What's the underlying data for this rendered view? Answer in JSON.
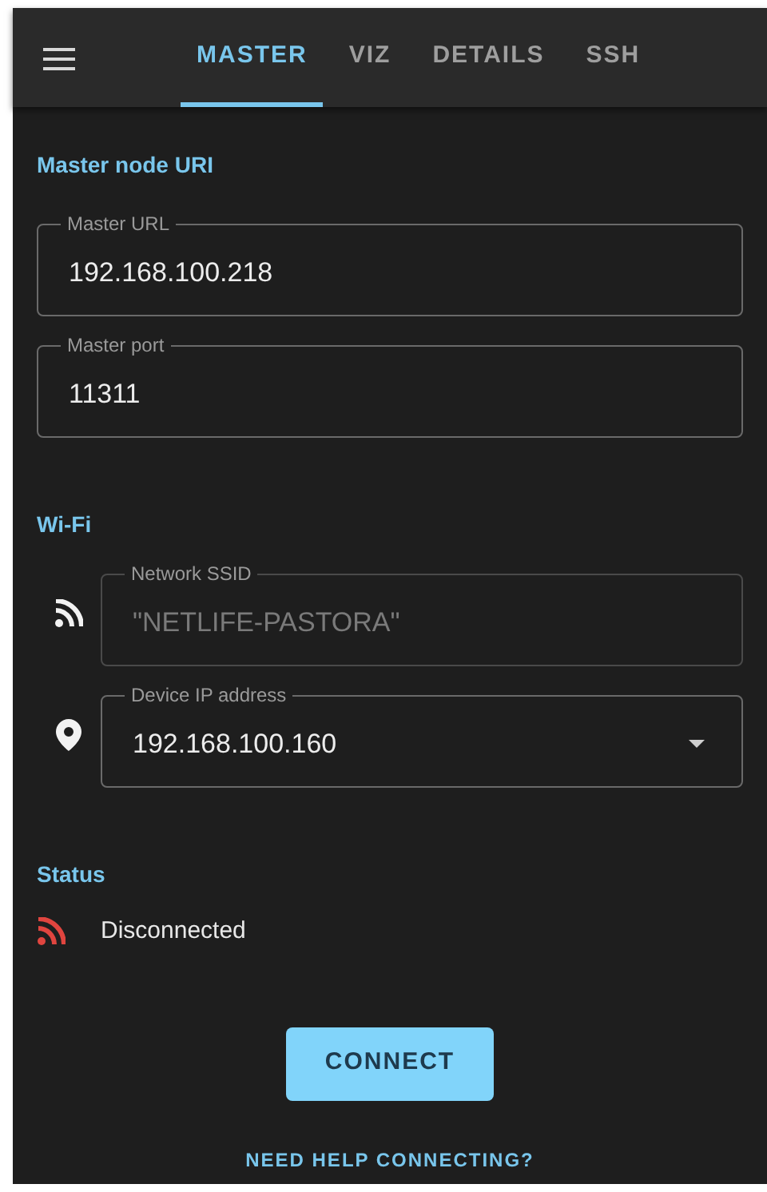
{
  "tabs": [
    {
      "label": "MASTER",
      "selected": true
    },
    {
      "label": "VIZ",
      "selected": false
    },
    {
      "label": "DETAILS",
      "selected": false
    },
    {
      "label": "SSH",
      "selected": false
    }
  ],
  "master": {
    "title": "Master node URI",
    "fields": [
      {
        "label": "Master URL",
        "value": "192.168.100.218",
        "kind": "text",
        "disabled": false
      },
      {
        "label": "Master port",
        "value": "11311",
        "kind": "text",
        "disabled": false
      }
    ]
  },
  "wifi": {
    "title": "Wi-Fi",
    "fields": [
      {
        "label": "Network SSID",
        "value": "\"NETLIFE-PASTORA\"",
        "kind": "text",
        "disabled": true
      },
      {
        "label": "Device IP address",
        "value": "192.168.100.160",
        "kind": "select",
        "disabled": false
      }
    ]
  },
  "status": {
    "title": "Status",
    "text": "Disconnected",
    "connected": false
  },
  "connect_button": "CONNECT",
  "help_link": "NEED HELP CONNECTING?"
}
